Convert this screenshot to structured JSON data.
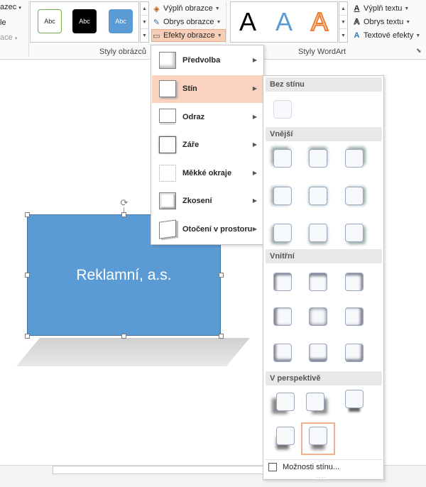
{
  "ribbon": {
    "left_items": [
      {
        "label": "azec",
        "arrow": "▾",
        "disabled": false
      },
      {
        "label": "le",
        "arrow": "",
        "disabled": false
      },
      {
        "label": "ace",
        "arrow": "▾",
        "disabled": true
      }
    ],
    "picture_styles": {
      "group_label": "Styly obrázců",
      "thumbs": [
        {
          "label": "Abc",
          "style": "green-border"
        },
        {
          "label": "Abc",
          "style": "black"
        },
        {
          "label": "Abc",
          "style": "blue"
        }
      ],
      "commands": [
        {
          "label": "Výplň obrazce",
          "icon": "paint-bucket-icon"
        },
        {
          "label": "Obrys obrazce",
          "icon": "pen-outline-icon"
        },
        {
          "label": "Efekty obrazce",
          "icon": "shape-effects-icon"
        }
      ]
    },
    "wordart_styles": {
      "group_label": "Styly WordArt",
      "thumbs": [
        "A",
        "A",
        "A"
      ],
      "commands": [
        {
          "label": "Výplň textu",
          "icon": "text-fill-icon"
        },
        {
          "label": "Obrys textu",
          "icon": "text-outline-icon"
        },
        {
          "label": "Textové efekty",
          "icon": "text-effects-icon"
        }
      ],
      "launcher": "⬊"
    },
    "colors": {
      "accent": "#f1a981",
      "active_bg": "#f7cfb8"
    }
  },
  "effects_menu": {
    "items": [
      {
        "label": "Předvolba",
        "icon": "preset-icon"
      },
      {
        "label": "Stín",
        "icon": "shadow-icon"
      },
      {
        "label": "Odraz",
        "icon": "reflection-icon"
      },
      {
        "label": "Záře",
        "icon": "glow-icon"
      },
      {
        "label": "Měkké okraje",
        "icon": "soft-edges-icon"
      },
      {
        "label": "Zkosení",
        "icon": "bevel-icon"
      },
      {
        "label": "Otočení v prostoru",
        "icon": "3d-rotation-icon"
      }
    ],
    "active_index": 1
  },
  "shadow_submenu": {
    "sections": [
      {
        "title": "Bez stínu"
      },
      {
        "title": "Vnější"
      },
      {
        "title": "Vnitřní"
      },
      {
        "title": "V perspektivě"
      }
    ],
    "footer_label": "Možnosti stínu..."
  },
  "canvas": {
    "shape_text": "Reklamní, a.s.",
    "shape_color": "#5b9bd5"
  }
}
